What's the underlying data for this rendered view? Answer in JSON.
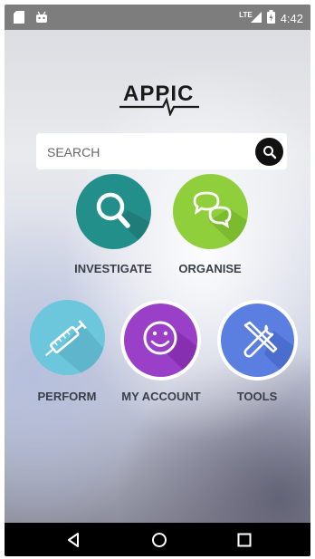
{
  "status_bar": {
    "time": "4:42",
    "network": "LTE",
    "icons": [
      "sd-card-icon",
      "android-icon",
      "signal-icon",
      "battery-icon"
    ]
  },
  "logo": {
    "text": "APPIC"
  },
  "search": {
    "placeholder": "SEARCH",
    "value": ""
  },
  "menu": {
    "investigate": {
      "label": "INVESTIGATE",
      "icon": "magnifier-icon",
      "color": "#238f8a"
    },
    "organise": {
      "label": "ORGANISE",
      "icon": "chat-bubbles-icon",
      "color": "#8fcf3c"
    },
    "perform": {
      "label": "PERFORM",
      "icon": "syringe-icon",
      "color": "#6cc6dc"
    },
    "my_account": {
      "label": "MY ACCOUNT",
      "icon": "smiley-icon",
      "color": "#9a3fc7"
    },
    "tools": {
      "label": "TOOLS",
      "icon": "wrench-screwdriver-icon",
      "color": "#5b7fe0"
    }
  },
  "nav_bar": {
    "icons": [
      "back-icon",
      "home-icon",
      "recents-icon"
    ]
  }
}
